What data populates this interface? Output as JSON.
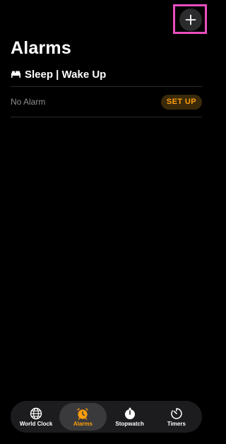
{
  "header": {
    "add_icon": "plus-icon",
    "title": "Alarms"
  },
  "sleep_section": {
    "icon": "bed-icon",
    "title": "Sleep | Wake Up",
    "row_label": "No Alarm",
    "setup_label": "SET UP"
  },
  "tab_bar": {
    "tabs": [
      {
        "label": "World Clock",
        "icon": "globe-icon",
        "active": false
      },
      {
        "label": "Alarms",
        "icon": "alarm-clock-icon",
        "active": true
      },
      {
        "label": "Stopwatch",
        "icon": "stopwatch-icon",
        "active": false
      },
      {
        "label": "Timers",
        "icon": "timer-icon",
        "active": false
      }
    ]
  },
  "colors": {
    "background": "#000000",
    "accent": "#ff9f0a",
    "highlight": "#e94fbf",
    "muted_text": "#8e8e93"
  }
}
